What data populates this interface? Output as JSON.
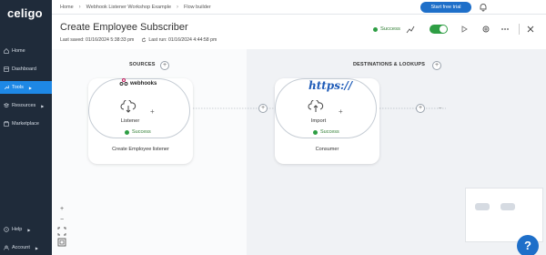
{
  "sidebar": {
    "logo": "celigo",
    "items": [
      {
        "label": "Home"
      },
      {
        "label": "Dashboard"
      },
      {
        "label": "Tools"
      },
      {
        "label": "Resources"
      },
      {
        "label": "Marketplace"
      }
    ],
    "help": "Help",
    "account": "Account"
  },
  "topbar": {
    "breadcrumbs": [
      "Home",
      "Webhook Listener Workshop Example",
      "Flow builder"
    ],
    "trial_button": "Start free trial"
  },
  "header": {
    "title": "Create Employee Subscriber",
    "last_saved": "Last saved: 01/16/2024 5:38:33 pm",
    "last_run": "Last run: 01/16/2024 4:44:58 pm",
    "status": "Success"
  },
  "sources": {
    "label": "SOURCES",
    "step": {
      "app": "webhooks",
      "name": "Listener",
      "status": "Success",
      "footer": "Create Employee listener"
    }
  },
  "destinations": {
    "label": "DESTINATIONS & LOOKUPS",
    "step": {
      "app": "https://",
      "name": "Import",
      "status": "Success",
      "footer": "Consumer"
    }
  },
  "zoom": [
    "+",
    "−"
  ],
  "help_fab": "?",
  "colors": {
    "sidebar_bg": "#1f2b3a",
    "accent": "#1e88e5",
    "success": "#2e9e44",
    "brand_button": "#1e6fc9"
  }
}
